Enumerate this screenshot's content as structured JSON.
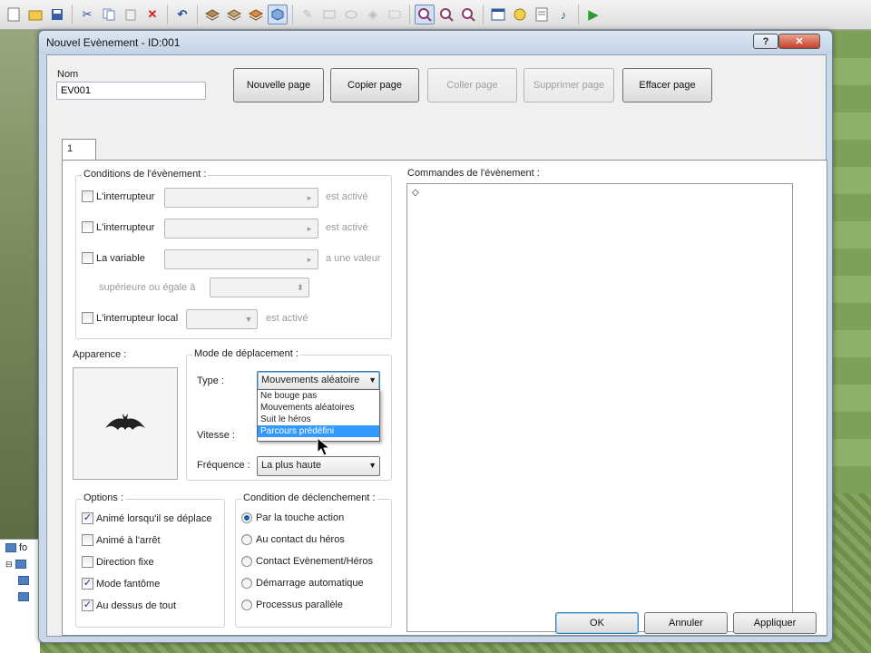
{
  "toolbar": {
    "icons": [
      "new-icon",
      "open-icon",
      "save-icon",
      "cut-icon",
      "copy-icon",
      "paste-icon",
      "delete-icon",
      "undo-icon",
      "layer1-icon",
      "layer2-icon",
      "layer3-icon",
      "event-layer-icon",
      "pencil-icon",
      "rectangle-icon",
      "ellipse-icon",
      "fill-icon",
      "select-icon",
      "zoom-1-icon",
      "zoom-2-icon",
      "zoom-3-icon",
      "database-icon",
      "resources-icon",
      "script-editor-icon",
      "sound-test-icon",
      "playtest-icon"
    ]
  },
  "tree": {
    "items": [
      "fo",
      ""
    ]
  },
  "dialog": {
    "title": "Nouvel Evènement - ID:001",
    "help_glyph": "?",
    "close_glyph": "✕",
    "name_label": "Nom",
    "name_value": "EV001",
    "buttons": {
      "new_page": "Nouvelle page",
      "copy_page": "Copier page",
      "paste_page": "Coller page",
      "delete_page": "Supprimer page",
      "clear_page": "Effacer page"
    },
    "tab_label": "1",
    "conditions": {
      "title": "Conditions de l'évènement :",
      "switch1_label": "L'interrupteur",
      "switch1_suffix": "est activé",
      "switch2_label": "L'interrupteur",
      "switch2_suffix": "est activé",
      "variable_label": "La variable",
      "variable_suffix": "a une valeur",
      "variable_compare": "supérieure ou égale à",
      "local_switch_label": "L'interrupteur local",
      "local_switch_suffix": "est activé"
    },
    "appearance": {
      "title": "Apparence :"
    },
    "movement": {
      "title": "Mode de déplacement :",
      "type_label": "Type :",
      "type_value": "Mouvements aléatoire",
      "type_options": [
        "Ne bouge pas",
        "Mouvements aléatoires",
        "Suit le héros",
        "Parcours prédéfini"
      ],
      "type_highlighted_index": 3,
      "speed_label": "Vitesse :",
      "frequency_label": "Fréquence :",
      "frequency_value": "La plus haute"
    },
    "options": {
      "title": "Options :",
      "items": [
        {
          "label": "Animé lorsqu'il se déplace",
          "checked": true
        },
        {
          "label": "Animé à l'arrêt",
          "checked": false
        },
        {
          "label": "Direction fixe",
          "checked": false
        },
        {
          "label": "Mode fantôme",
          "checked": true
        },
        {
          "label": "Au dessus de tout",
          "checked": true
        }
      ]
    },
    "trigger": {
      "title": "Condition de déclenchement :",
      "items": [
        {
          "label": "Par la touche action",
          "selected": true
        },
        {
          "label": "Au contact du héros",
          "selected": false
        },
        {
          "label": "Contact Evènement/Héros",
          "selected": false
        },
        {
          "label": "Démarrage automatique",
          "selected": false
        },
        {
          "label": "Processus parallèle",
          "selected": false
        }
      ]
    },
    "commands": {
      "title": "Commandes de l'évènement :",
      "first_line": "◇"
    },
    "footer": {
      "ok": "OK",
      "cancel": "Annuler",
      "apply": "Appliquer"
    }
  }
}
